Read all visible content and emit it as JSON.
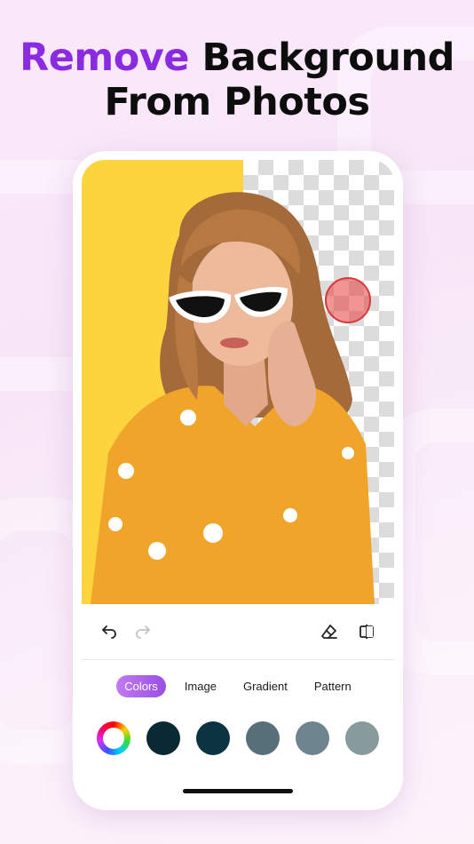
{
  "headline": {
    "accent": "Remove",
    "line1_rest": " Background",
    "line2": "From Photos"
  },
  "colors": {
    "accent": "#8a2be2",
    "photo_background": "#fdd33e",
    "tab_active_start": "#c17bf0",
    "tab_active_end": "#9b4de6"
  },
  "toolbar": {
    "undo_icon": "undo-icon",
    "redo_icon": "redo-icon",
    "eraser_icon": "eraser-icon",
    "compare_icon": "compare-icon"
  },
  "tabs": [
    {
      "label": "Colors",
      "active": true
    },
    {
      "label": "Image",
      "active": false
    },
    {
      "label": "Gradient",
      "active": false
    },
    {
      "label": "Pattern",
      "active": false
    }
  ],
  "swatches": [
    "#0a2a33",
    "#0c3340",
    "#566f78",
    "#6e8590",
    "#889b9c"
  ]
}
